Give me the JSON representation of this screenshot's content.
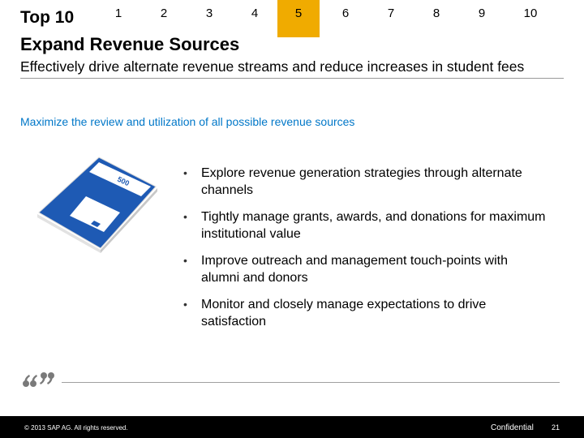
{
  "header": {
    "top_label": "Top 10",
    "nav": [
      {
        "label": "1",
        "active": false
      },
      {
        "label": "2",
        "active": false
      },
      {
        "label": "3",
        "active": false
      },
      {
        "label": "4",
        "active": false
      },
      {
        "label": "5",
        "active": true
      },
      {
        "label": "6",
        "active": false
      },
      {
        "label": "7",
        "active": false
      },
      {
        "label": "8",
        "active": false
      },
      {
        "label": "9",
        "active": false
      },
      {
        "label": "10",
        "active": false
      }
    ],
    "active_color": "#f0ab00"
  },
  "slide": {
    "title": "Expand Revenue Sources",
    "subtitle": "Effectively drive alternate revenue streams and reduce increases in student fees",
    "lead": "Maximize the review and utilization of all possible revenue sources",
    "lead_color": "#0077c8",
    "bullets": [
      "Explore revenue generation strategies through alternate channels",
      "Tightly manage grants, awards, and donations for maximum institutional value",
      "Improve outreach and management touch-points with alumni and donors",
      "Monitor and closely manage expectations to drive satisfaction"
    ],
    "illustration": "calculator-icon",
    "quote_icon": "quote-icon"
  },
  "footer": {
    "copyright": "© 2013 SAP AG. All rights reserved.",
    "confidential": "Confidential",
    "page_number": "21"
  }
}
